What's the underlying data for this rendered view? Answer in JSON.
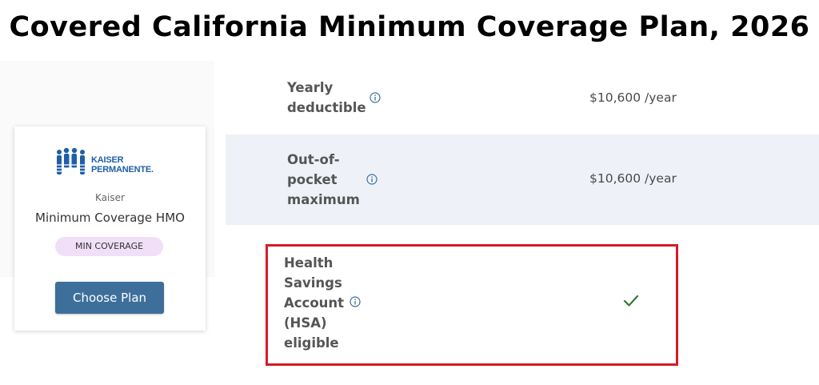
{
  "page": {
    "title": "Covered California Minimum Coverage Plan, 2026"
  },
  "plan_card": {
    "logo_line1": "KAISER",
    "logo_line2": "PERMANENTE.",
    "carrier": "Kaiser",
    "plan_name": "Minimum Coverage HMO",
    "badge": "MIN COVERAGE",
    "choose_label": "Choose Plan"
  },
  "benefits": [
    {
      "label_lines": [
        "Yearly",
        "deductible"
      ],
      "value": "$10,600 /year"
    },
    {
      "label_lines": [
        "Out-of-",
        "pocket",
        "maximum"
      ],
      "value": "$10,600 /year"
    },
    {
      "label_lines": [
        "Health",
        "Savings",
        "Account",
        "(HSA)",
        "eligible"
      ],
      "value_icon": "check-icon"
    }
  ],
  "colors": {
    "button": "#3e6f9b",
    "badge_bg": "#f0dff7",
    "highlight_border": "#d41c28",
    "check": "#2e7d32",
    "logo_blue": "#1f5fa6",
    "stripe": "#eef2f8"
  },
  "icons": {
    "info": "info-icon",
    "logo": "kaiser-permanente-logo"
  }
}
